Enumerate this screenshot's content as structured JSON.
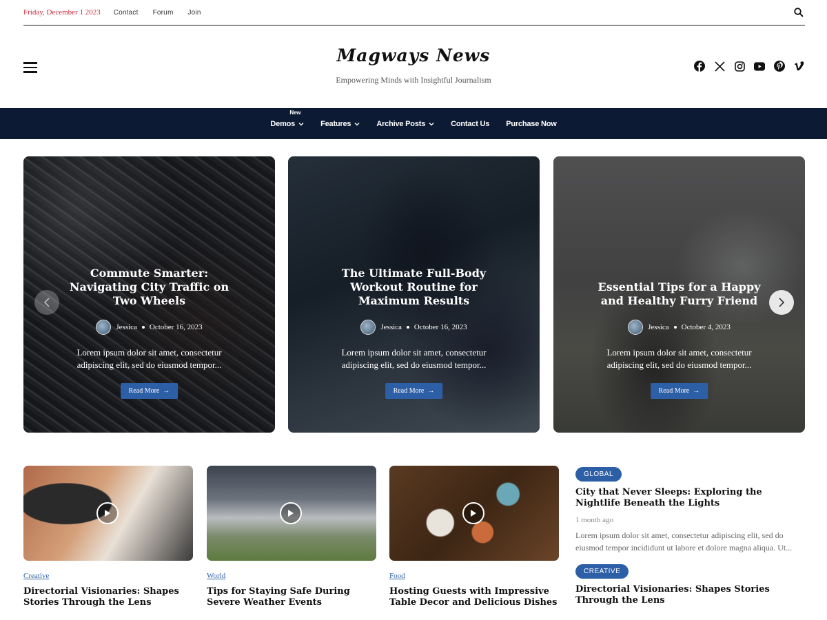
{
  "topbar": {
    "date": "Friday, December 1 2023",
    "links": [
      "Contact",
      "Forum",
      "Join"
    ]
  },
  "header": {
    "logo": "Magways News",
    "tagline": "Empowering Minds with Insightful Journalism",
    "socials": [
      "facebook-icon",
      "x-icon",
      "instagram-icon",
      "youtube-icon",
      "pinterest-icon",
      "vimeo-icon"
    ]
  },
  "nav": {
    "items": [
      {
        "label": "Demos",
        "badge": "New",
        "dropdown": true
      },
      {
        "label": "Features",
        "dropdown": true
      },
      {
        "label": "Archive Posts",
        "dropdown": true
      },
      {
        "label": "Contact Us",
        "dropdown": false
      },
      {
        "label": "Purchase Now",
        "dropdown": false
      }
    ]
  },
  "slides": [
    {
      "title": "Commute Smarter: Navigating City Traffic on Two Wheels",
      "author": "Jessica",
      "date": "October 16, 2023",
      "excerpt": "Lorem ipsum dolor sit amet, consectetur adipiscing elit, sed do eiusmod tempor...",
      "button": "Read More"
    },
    {
      "title": "The Ultimate Full-Body Workout Routine for Maximum Results",
      "author": "Jessica",
      "date": "October 16, 2023",
      "excerpt": "Lorem ipsum dolor sit amet, consectetur adipiscing elit, sed do eiusmod tempor...",
      "button": "Read More"
    },
    {
      "title": "Essential Tips for a Happy and Healthy Furry Friend",
      "author": "Jessica",
      "date": "October 4, 2023",
      "excerpt": "Lorem ipsum dolor sit amet, consectetur adipiscing elit, sed do eiusmod tempor...",
      "button": "Read More"
    }
  ],
  "cards": [
    {
      "category": "Creative",
      "title": "Directorial Visionaries: Shapes Stories Through the Lens"
    },
    {
      "category": "World",
      "title": "Tips for Staying Safe During Severe Weather Events"
    },
    {
      "category": "Food",
      "title": "Hosting Guests with Impressive Table Decor and Delicious Dishes"
    }
  ],
  "side": [
    {
      "category": "GLOBAL",
      "title": "City that Never Sleeps: Exploring the Nightlife Beneath the Lights",
      "time": "1 month ago",
      "excerpt": "Lorem ipsum dolor sit amet, consectetur adipiscing elit, sed do eiusmod tempor incididunt ut labore et dolore magna aliqua. Ut..."
    },
    {
      "category": "CREATIVE",
      "title": "Directorial Visionaries: Shapes Stories Through the Lens"
    }
  ],
  "colors": {
    "accent": "#2d5fa6",
    "nav_bg": "#0d1a33",
    "date_red": "#c8283a"
  }
}
